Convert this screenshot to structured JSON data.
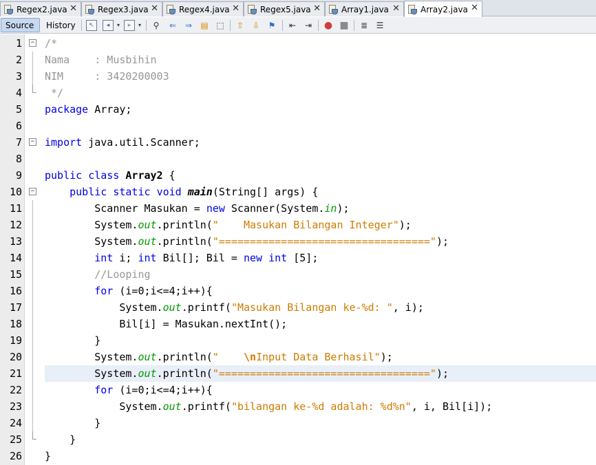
{
  "tabs": [
    {
      "label": "Regex2.java",
      "active": false
    },
    {
      "label": "Regex3.java",
      "active": false
    },
    {
      "label": "Regex4.java",
      "active": false
    },
    {
      "label": "Regex5.java",
      "active": false
    },
    {
      "label": "Array1.java",
      "active": false
    },
    {
      "label": "Array2.java",
      "active": true
    }
  ],
  "close_glyph": "✕",
  "toolbar": {
    "source_label": "Source",
    "history_label": "History",
    "icons": [
      "last-edit-icon",
      "back-icon",
      "forward-icon",
      "find-icon",
      "find-prev-icon",
      "find-next-icon",
      "toggle-highlight-icon",
      "rect-select-icon",
      "prev-bookmark-icon",
      "next-bookmark-icon",
      "toggle-bookmark-icon",
      "shift-left-icon",
      "shift-right-icon",
      "start-macro-icon",
      "stop-macro-icon",
      "comment-icon",
      "uncomment-icon"
    ]
  },
  "editor": {
    "highlight_line": 21,
    "lines": [
      "/*",
      "Nama    : Musbihin",
      "NIM     : 3420200003",
      " */",
      "package Array;",
      "",
      "import java.util.Scanner;",
      "",
      "public class Array2 {",
      "    public static void main(String[] args) {",
      "        Scanner Masukan = new Scanner(System.in);",
      "        System.out.println(\"    Masukan Bilangan Integer\");",
      "        System.out.println(\"==================================\");",
      "        int i; int Bil[]; Bil = new int [5];",
      "        //Looping",
      "        for (i=0;i<=4;i++){",
      "            System.out.printf(\"Masukan Bilangan ke-%d: \", i);",
      "            Bil[i] = Masukan.nextInt();",
      "        }",
      "        System.out.println(\"    \\nInput Data Berhasil\");",
      "        System.out.println(\"==================================\");",
      "        for (i=0;i<=4;i++){",
      "            System.out.printf(\"bilangan ke-%d adalah: %d%n\", i, Bil[i]);",
      "        }",
      "    }",
      "}"
    ]
  },
  "colors": {
    "keyword": "#0000e6",
    "comment": "#969696",
    "string": "#ce7b00",
    "field": "#009900",
    "current_line": "#e9eff8"
  }
}
